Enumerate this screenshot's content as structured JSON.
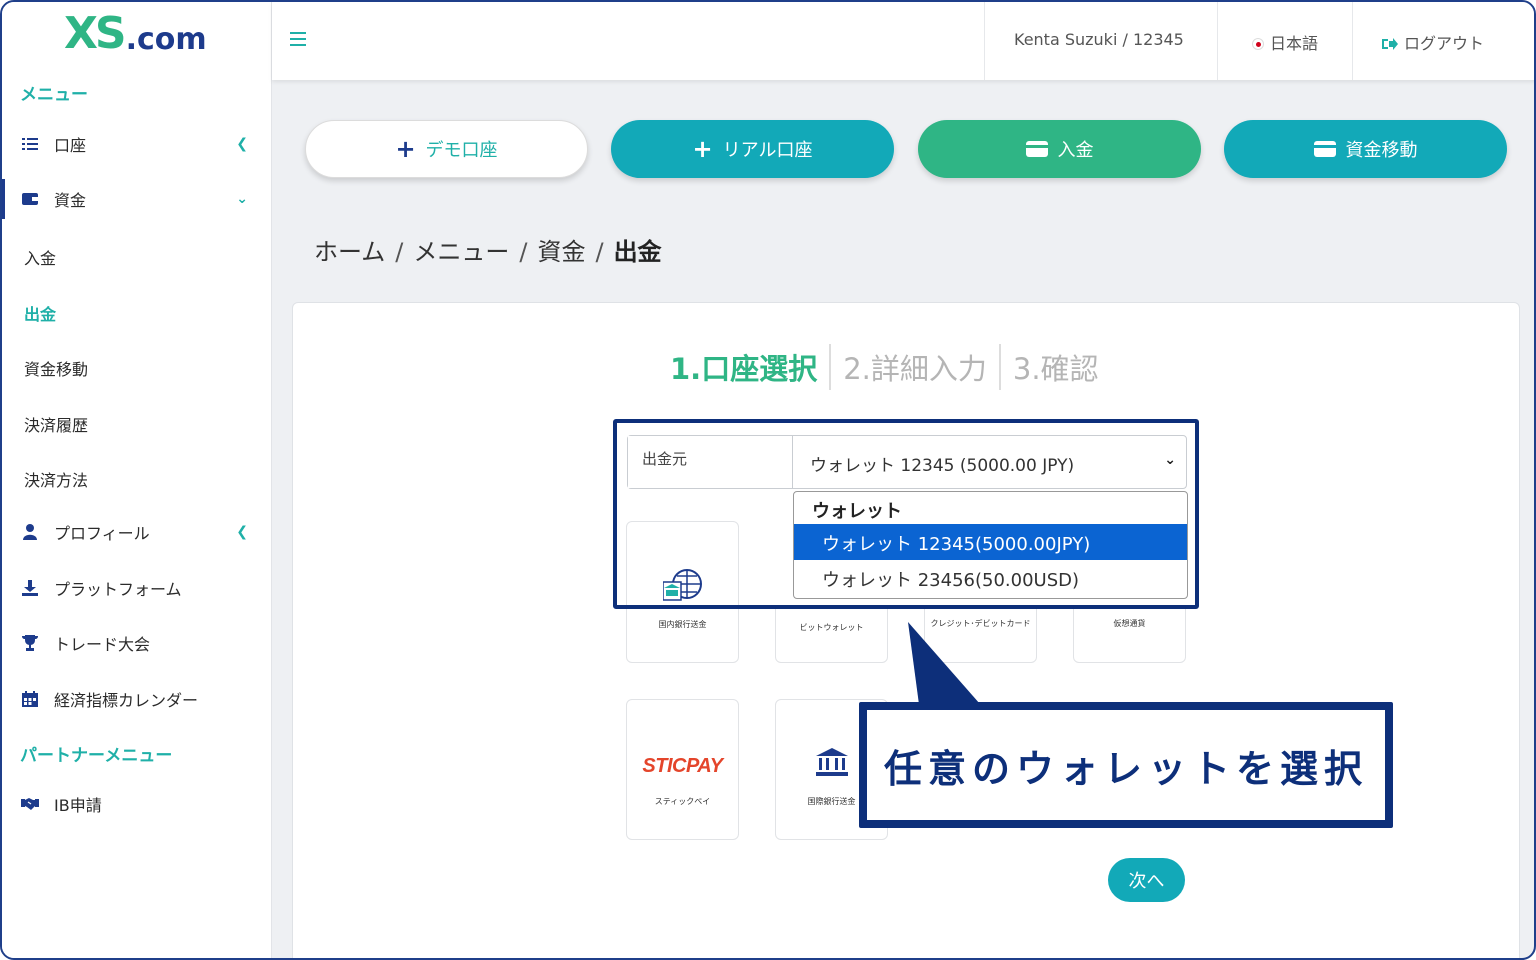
{
  "brand": {
    "logo_main": "XS",
    "logo_suffix": ".com"
  },
  "sidebar": {
    "menu_title": "メニュー",
    "items": [
      {
        "label": "口座",
        "icon": "list-icon"
      },
      {
        "label": "資金",
        "icon": "wallet-icon"
      },
      {
        "label": "プロフィール",
        "icon": "user-icon"
      },
      {
        "label": "プラットフォーム",
        "icon": "download-icon"
      },
      {
        "label": "トレード大会",
        "icon": "trophy-icon"
      },
      {
        "label": "経済指標カレンダー",
        "icon": "calendar-icon"
      }
    ],
    "funds_sub": [
      "入金",
      "出金",
      "資金移動",
      "決済履歴",
      "決済方法"
    ],
    "partner_title": "パートナーメニュー",
    "partner_items": [
      {
        "label": "IB申請",
        "icon": "handshake-icon"
      }
    ]
  },
  "topbar": {
    "user": "Kenta Suzuki / 12345",
    "language": "日本語",
    "logout": "ログアウト"
  },
  "actions": {
    "demo": "デモ口座",
    "real": "リアル口座",
    "deposit": "入金",
    "transfer": "資金移動"
  },
  "breadcrumb": {
    "home": "ホーム",
    "menu": "メニュー",
    "funds": "資金",
    "current": "出金",
    "sep": "/"
  },
  "steps": {
    "s1": "1.口座選択",
    "s2": "2.詳細入力",
    "s3": "3.確認"
  },
  "form": {
    "label": "出金元",
    "selected": "ウォレット 12345 (5000.00 JPY)",
    "group": "ウォレット",
    "options": [
      "ウォレット 12345(5000.00JPY)",
      "ウォレット 23456(50.00USD)"
    ]
  },
  "methods": {
    "domestic": "国内銀行送金",
    "bitwallet": "ビットウォレット",
    "card": "クレジット･デビットカード",
    "crypto": "仮想通貨",
    "sticpay_logo": "STICPAY",
    "sticpay": "スティックペイ",
    "intl": "国際銀行送金"
  },
  "next": "次へ",
  "callout": "任意のウォレットを選択",
  "colors": {
    "teal": "#12a9b8",
    "green": "#2fb585",
    "navy": "#0d2f7a",
    "select_blue": "#0b64d2"
  }
}
